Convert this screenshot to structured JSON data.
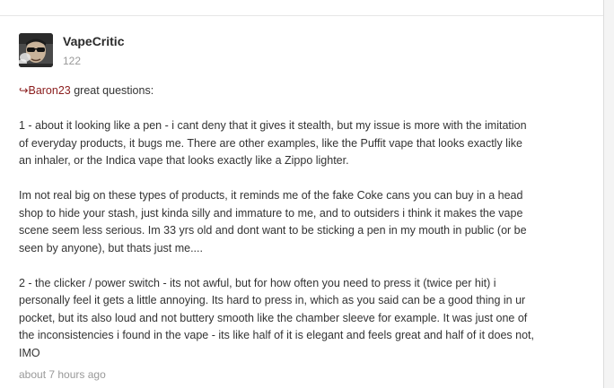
{
  "author": {
    "name": "VapeCritic",
    "reputation": "122",
    "avatar_icon": "user-avatar-sunglasses"
  },
  "post": {
    "reply_arrow": "↪",
    "mention": "Baron23",
    "greeting": " great questions:",
    "paragraph1": [
      "1 - about it looking like a pen - i cant deny that it gives it stealth, but my issue is more with the imitation",
      "of everyday products, it bugs me. There are other examples, like the Puffit vape that looks exactly like",
      "an inhaler, or the Indica vape that looks exactly like a Zippo lighter."
    ],
    "paragraph2": [
      "Im not real big on these types of products, it reminds me of the fake Coke cans you can buy in a head",
      "shop to hide your stash, just kinda silly and immature to me, and to outsiders i think it makes the vape",
      "scene seem less serious. Im 33 yrs old and dont want to be sticking a pen in my mouth in public (or be",
      "seen by anyone), but thats just me...."
    ],
    "paragraph3": [
      "2 - the clicker / power switch - its not awful, but for how often you need to press it (twice per hit) i",
      "personally feel it gets a little annoying. Its hard to press in, which as you said can be a good thing in ur",
      "pocket, but its also loud and not buttery smooth like the chamber sleeve for example. It was just one of",
      "the inconsistencies i found in the vape - its like half of it is elegant and feels great and half of it does not,",
      "IMO"
    ]
  },
  "timestamp": "about 7 hours ago",
  "colors": {
    "mention": "#8a1c1c",
    "text": "#333333",
    "muted": "#999999"
  }
}
